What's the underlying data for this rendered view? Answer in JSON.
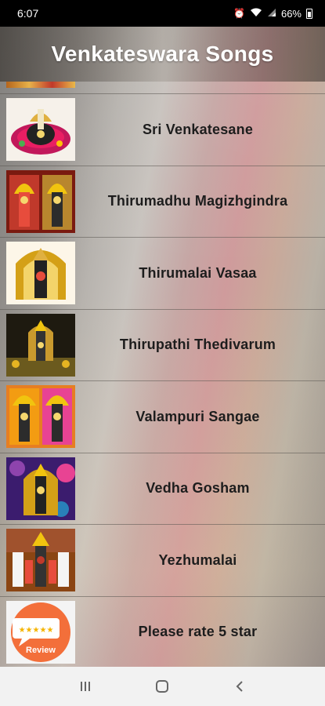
{
  "status_bar": {
    "time": "6:07",
    "battery": "66%",
    "icons": [
      "alarm-icon",
      "wifi-icon",
      "signal-icon",
      "battery-icon"
    ]
  },
  "app_bar": {
    "title": "Venkateswara Songs"
  },
  "songs": [
    {
      "title": "Sri Venkatesane",
      "thumb": "deity-icon"
    },
    {
      "title": "Thirumadhu Magizhgindra",
      "thumb": "deity-icon"
    },
    {
      "title": "Thirumalai Vasaa",
      "thumb": "deity-icon"
    },
    {
      "title": "Thirupathi Thedivarum",
      "thumb": "deity-icon"
    },
    {
      "title": "Valampuri Sangae",
      "thumb": "deity-icon"
    },
    {
      "title": "Vedha Gosham",
      "thumb": "deity-icon"
    },
    {
      "title": "Yezhumalai",
      "thumb": "deity-icon"
    },
    {
      "title": "Please rate 5 star",
      "thumb": "review-icon",
      "thumb_label": "Review"
    }
  ],
  "nav_bar": {
    "buttons": [
      "recents-icon",
      "home-icon",
      "back-icon"
    ]
  },
  "colors": {
    "title_text": "#ffffff",
    "row_text": "#1d1d1d",
    "nav_bg": "#f2f2f2"
  }
}
